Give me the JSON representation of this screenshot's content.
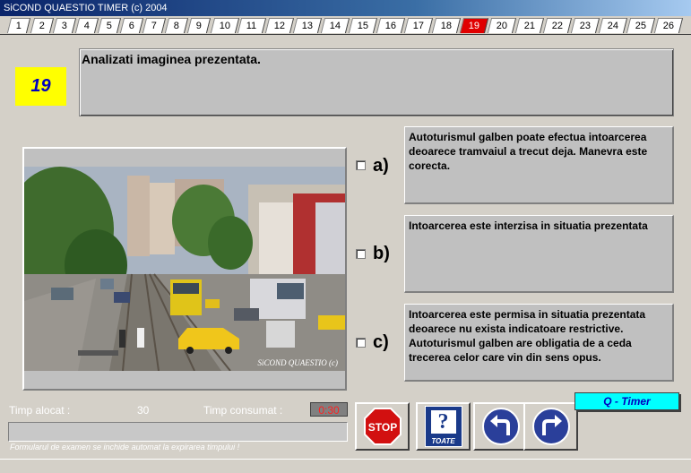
{
  "window": {
    "title": "SiCOND QUAESTIO TIMER (c) 2004"
  },
  "tabs": [
    "1",
    "2",
    "3",
    "4",
    "5",
    "6",
    "7",
    "8",
    "9",
    "10",
    "11",
    "12",
    "13",
    "14",
    "15",
    "16",
    "17",
    "18",
    "19",
    "20",
    "21",
    "22",
    "23",
    "24",
    "25",
    "26"
  ],
  "active_tab": "19",
  "question": {
    "number": "19",
    "text": "Analizati imaginea prezentata."
  },
  "photo": {
    "watermark": "SiCOND QUAESTIO (c)"
  },
  "options": [
    {
      "letter": "a)",
      "text": "Autoturismul galben poate efectua intoarcerea deoarece tramvaiul a trecut deja. Manevra este corecta."
    },
    {
      "letter": "b)",
      "text": "Intoarcerea este interzisa in situatia prezentata"
    },
    {
      "letter": "c)",
      "text": "Intoarcerea este permisa in situatia prezentata deoarece nu exista indicatoare restrictive. Autoturismul galben are obligatia de a ceda trecerea celor care vin din sens opus."
    }
  ],
  "timer": {
    "allocated_label": "Timp alocat :",
    "allocated_value": "30",
    "consumed_label": "Timp consumat :",
    "consumed_value": "0:30",
    "progress": 0,
    "note": "Formularul de examen se inchide automat la expirarea timpului !"
  },
  "buttons": {
    "stop": "STOP",
    "all": "TOATE"
  },
  "brand": {
    "label": "Q - Timer"
  },
  "colors": {
    "accent_tab": "#e00000",
    "number_bg": "#ffff00",
    "brand_bg": "#00ffff"
  }
}
